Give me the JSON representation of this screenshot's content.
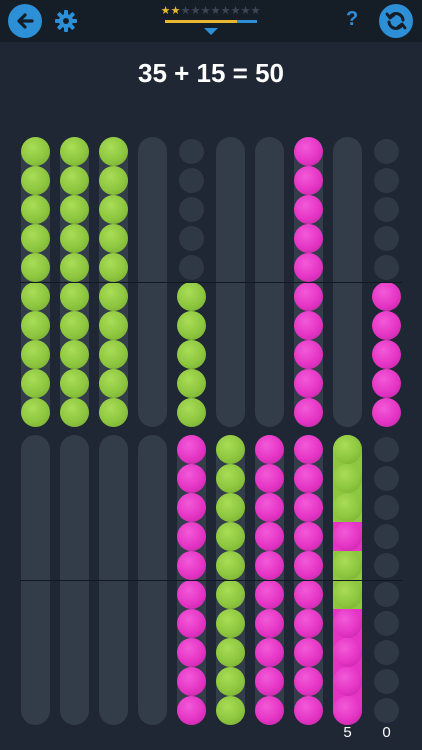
{
  "header": {
    "stars_filled": 2,
    "stars_total": 10,
    "progress_fraction": 0.78,
    "help_label": "?"
  },
  "equation": "35 + 15 = 50",
  "colors": {
    "green": "#8dc63f",
    "pink": "#e534c5",
    "accent": "#2d8fd6",
    "star": "#e9b830"
  },
  "upper_rows": [
    {
      "type": "rail",
      "fill": "green",
      "count": 10
    },
    {
      "type": "rail",
      "fill": "green",
      "count": 10
    },
    {
      "type": "rail",
      "fill": "green",
      "count": 10
    },
    {
      "type": "rail",
      "fill": "empty",
      "count": 0
    },
    {
      "type": "dots",
      "fill": "green",
      "count": 5
    },
    {
      "type": "rail",
      "fill": "empty",
      "count": 0
    },
    {
      "type": "rail",
      "fill": "empty",
      "count": 0
    },
    {
      "type": "rail",
      "fill": "pink",
      "count": 10
    },
    {
      "type": "rail",
      "fill": "empty",
      "count": 0
    },
    {
      "type": "dots",
      "fill": "pink",
      "count": 5
    }
  ],
  "lower_rows": [
    {
      "type": "rail",
      "fill": "empty",
      "count": 0
    },
    {
      "type": "rail",
      "fill": "empty",
      "count": 0
    },
    {
      "type": "rail",
      "fill": "empty",
      "count": 0
    },
    {
      "type": "rail",
      "fill": "empty",
      "count": 0
    },
    {
      "type": "rail",
      "fill": "pink",
      "count": 10
    },
    {
      "type": "rail",
      "fill": "green",
      "count": 10
    },
    {
      "type": "rail",
      "fill": "pink",
      "count": 10
    },
    {
      "type": "rail",
      "fill": "pink",
      "count": 10
    },
    {
      "type": "mixed",
      "pattern": [
        "green",
        "green",
        "green",
        "pink",
        "green",
        "green",
        "pink",
        "pink",
        "pink",
        "pink"
      ]
    },
    {
      "type": "dots",
      "fill": "none",
      "count": 0
    }
  ],
  "counts": [
    "5",
    "0"
  ]
}
